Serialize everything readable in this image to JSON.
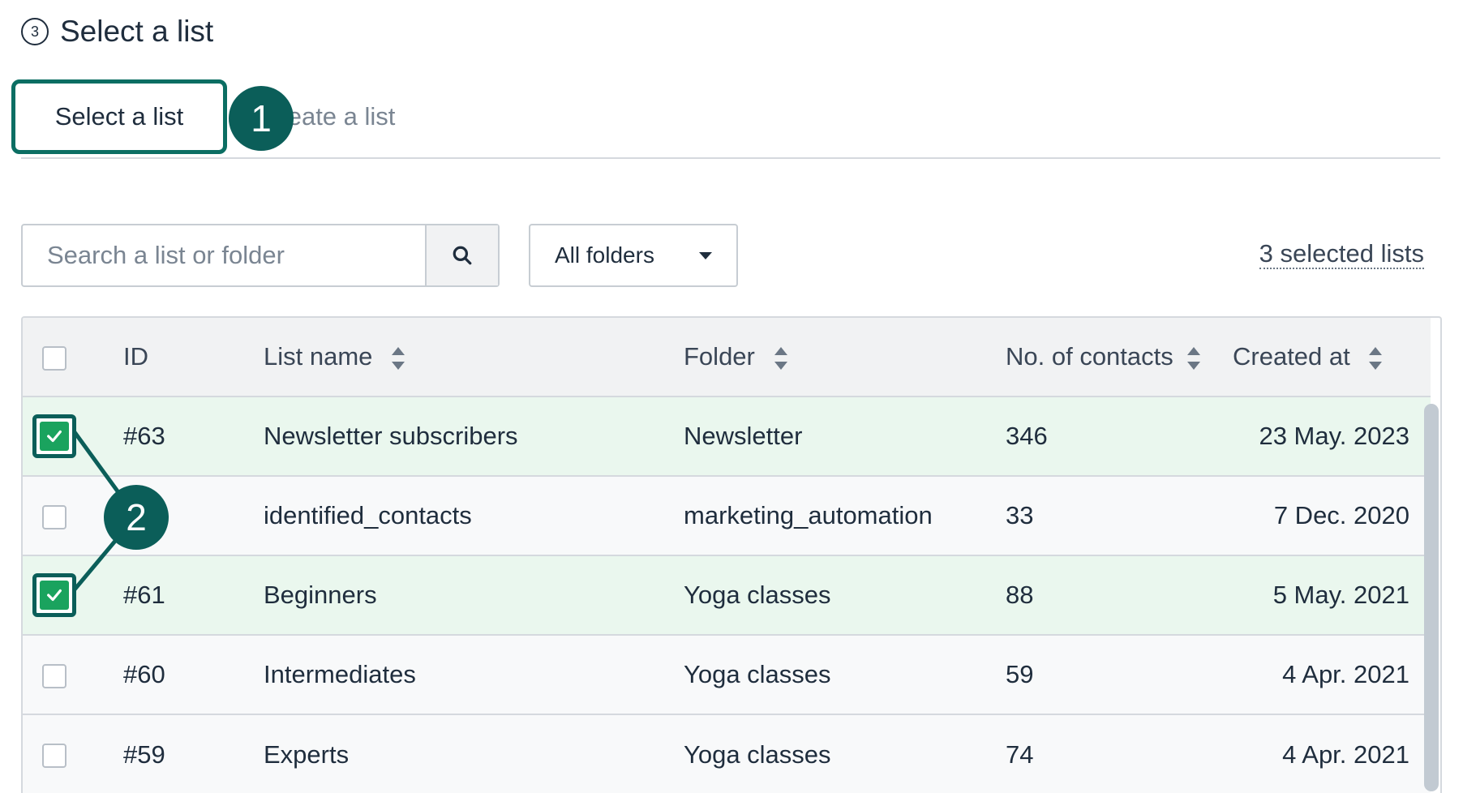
{
  "step": {
    "number": "3",
    "title": "Select a list"
  },
  "tabs": [
    {
      "label": "Select a list",
      "active": true
    },
    {
      "label": "Create a list",
      "active": false
    }
  ],
  "badges": {
    "one": "1",
    "two": "2"
  },
  "search": {
    "placeholder": "Search a list or folder",
    "value": ""
  },
  "folder_filter": {
    "selected": "All folders"
  },
  "selected_count_text": "3 selected lists",
  "table": {
    "headers": {
      "id": "ID",
      "name": "List name",
      "folder": "Folder",
      "contacts": "No. of contacts",
      "created": "Created at"
    },
    "rows": [
      {
        "id": "#63",
        "name": "Newsletter subscribers",
        "folder": "Newsletter",
        "contacts": "346",
        "created": "23 May. 2023",
        "checked": true
      },
      {
        "id": "",
        "name": "identified_contacts",
        "folder": "marketing_automation",
        "contacts": "33",
        "created": "7 Dec. 2020",
        "checked": false
      },
      {
        "id": "#61",
        "name": "Beginners",
        "folder": "Yoga classes",
        "contacts": "88",
        "created": "5 May. 2021",
        "checked": true
      },
      {
        "id": "#60",
        "name": "Intermediates",
        "folder": "Yoga classes",
        "contacts": "59",
        "created": "4 Apr. 2021",
        "checked": false
      },
      {
        "id": "#59",
        "name": "Experts",
        "folder": "Yoga classes",
        "contacts": "74",
        "created": "4 Apr. 2021",
        "checked": false
      }
    ]
  },
  "colors": {
    "accent": "#0b5e59",
    "check_green": "#1aa35e",
    "selected_row": "#eaf7ee"
  },
  "icons": {
    "search": "search-icon",
    "dropdown": "caret-down-icon",
    "sort": "sort-icon",
    "check": "checkmark-icon"
  }
}
